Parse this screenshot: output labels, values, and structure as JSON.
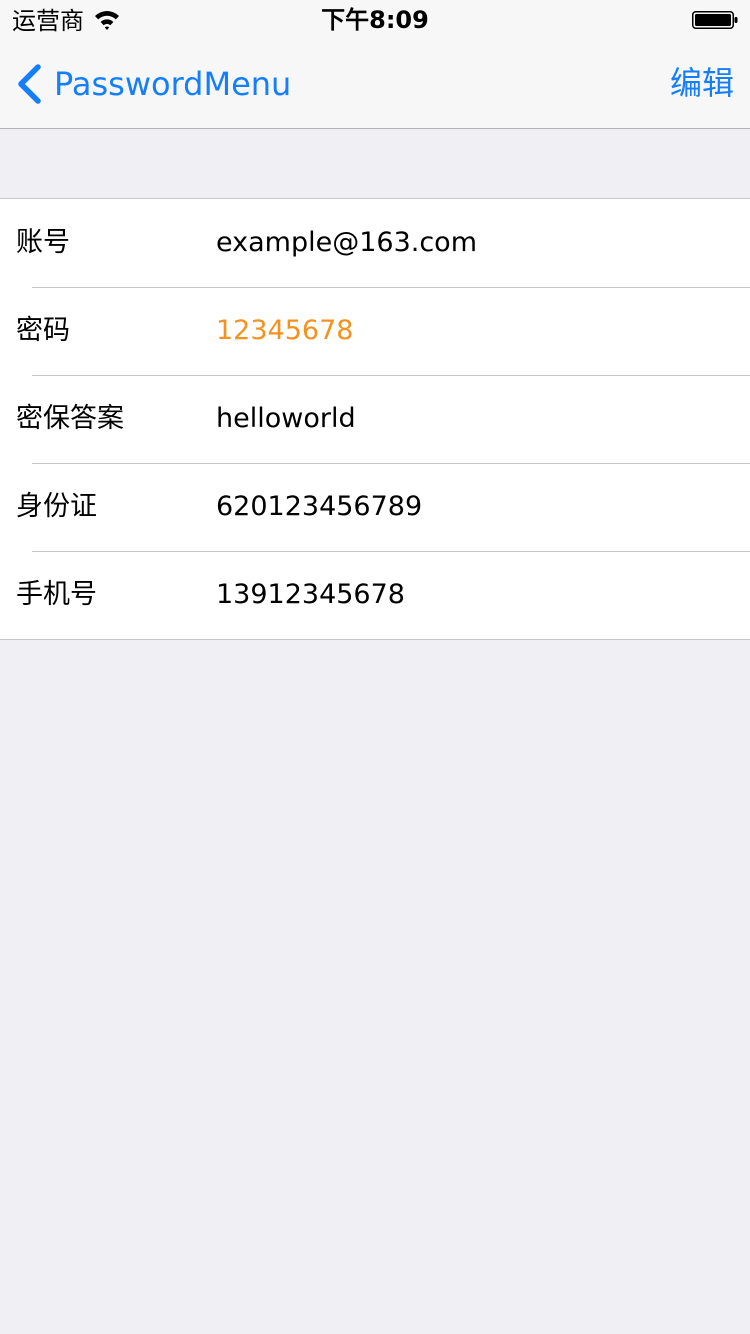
{
  "status_bar": {
    "carrier": "运营商",
    "time": "下午8:09",
    "wifi_icon": "wifi-icon",
    "battery_icon": "battery-full-icon"
  },
  "nav_bar": {
    "back_label": "PasswordMenu",
    "back_icon": "chevron-left-icon",
    "edit_label": "编辑",
    "accent_color": "#147efb"
  },
  "detail_rows": [
    {
      "label": "账号",
      "value": "example@163.com"
    },
    {
      "label": "密码",
      "value": "12345678"
    },
    {
      "label": "密保答案",
      "value": "helloworld"
    },
    {
      "label": "身份证",
      "value": "620123456789"
    },
    {
      "label": "手机号",
      "value": "13912345678"
    }
  ],
  "colors": {
    "password_value": "#f5911f",
    "background": "#efeff4",
    "separator": "#c8c7cc"
  }
}
